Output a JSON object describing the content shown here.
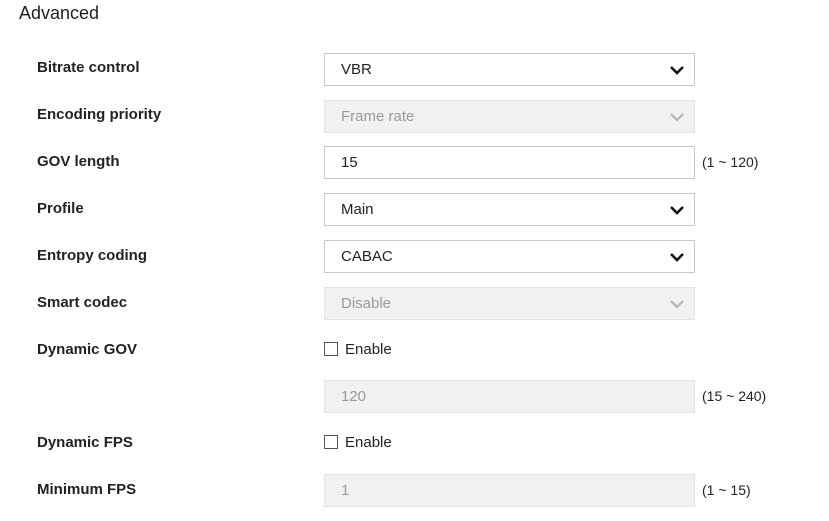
{
  "section": {
    "title": "Advanced"
  },
  "rows": {
    "bitrate_control": {
      "label": "Bitrate control",
      "value": "VBR"
    },
    "encoding_priority": {
      "label": "Encoding priority",
      "value": "Frame rate"
    },
    "gov_length": {
      "label": "GOV length",
      "value": "15",
      "range": "(1 ~ 120)"
    },
    "profile": {
      "label": "Profile",
      "value": "Main"
    },
    "entropy_coding": {
      "label": "Entropy coding",
      "value": "CABAC"
    },
    "smart_codec": {
      "label": "Smart codec",
      "value": "Disable"
    },
    "dynamic_gov": {
      "label": "Dynamic GOV",
      "checkbox_label": "Enable",
      "value": "120",
      "range": "(15 ~ 240)"
    },
    "dynamic_fps": {
      "label": "Dynamic FPS",
      "checkbox_label": "Enable"
    },
    "minimum_fps": {
      "label": "Minimum FPS",
      "value": "1",
      "range": "(1 ~ 15)"
    }
  },
  "icons": {
    "dropdown": "chevron-down-icon",
    "checkbox": "checkbox-unchecked"
  },
  "colors": {
    "disabled_bg": "#f1f1f1",
    "disabled_text": "#9a9a9a",
    "border": "#c8c8c8"
  }
}
